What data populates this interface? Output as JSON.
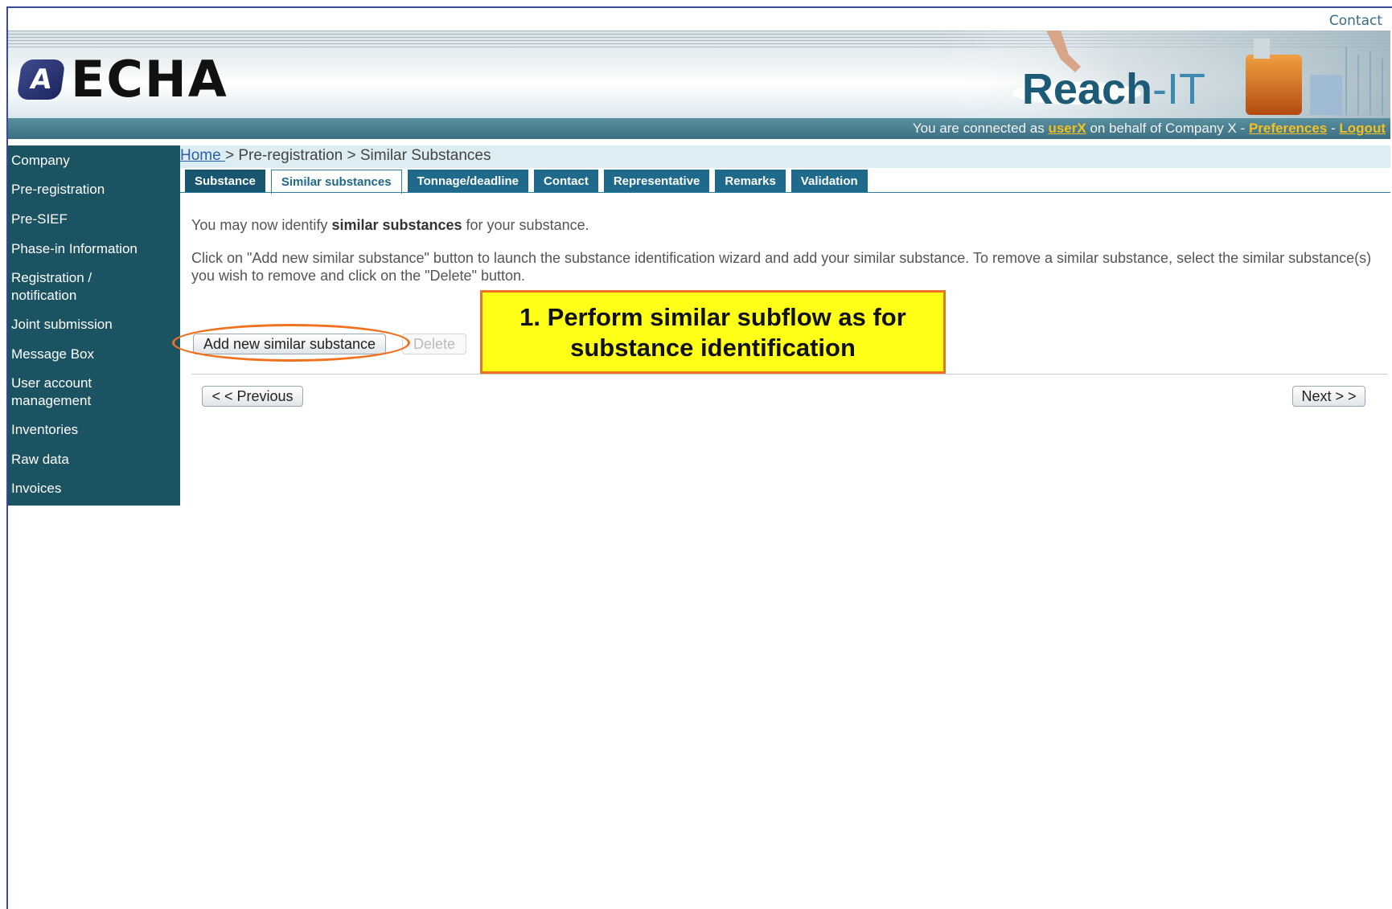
{
  "header": {
    "contact_link": "Contact",
    "logo_text": "ECHA",
    "logo_mark": "A",
    "product_name_main": "Reach",
    "product_name_suffix": "-IT",
    "connected_prefix": "You are connected as ",
    "user": "userX",
    "behalf_text": " on behalf of Company X - ",
    "preferences": "Preferences",
    "separator": " - ",
    "logout": "Logout"
  },
  "sidebar": {
    "items": [
      {
        "label": "Company"
      },
      {
        "label": "Pre-registration"
      },
      {
        "label": "Pre-SIEF"
      },
      {
        "label": "Phase-in Information"
      },
      {
        "label": "Registration / notification"
      },
      {
        "label": "Joint submission"
      },
      {
        "label": "Message Box"
      },
      {
        "label": "User account management"
      },
      {
        "label": "Inventories"
      },
      {
        "label": "Raw data"
      },
      {
        "label": "Invoices"
      }
    ]
  },
  "breadcrumb": {
    "home": "Home ",
    "rest": " > Pre-registration > Similar Substances"
  },
  "tabs": [
    {
      "label": "Substance"
    },
    {
      "label": "Similar substances"
    },
    {
      "label": "Tonnage/deadline"
    },
    {
      "label": "Contact"
    },
    {
      "label": "Representative"
    },
    {
      "label": "Remarks"
    },
    {
      "label": "Validation"
    }
  ],
  "content": {
    "intro_before": "You may now identify ",
    "intro_bold": "similar substances",
    "intro_after": " for your substance.",
    "instructions": "Click on \"Add new similar substance\" button to launch the substance identification wizard and add your similar substance. To remove a similar substance, select the similar substance(s) you wish to remove and click on the \"Delete\" button.",
    "add_button": "Add new similar substance",
    "delete_button": "Delete",
    "previous_button": "< < Previous",
    "next_button": "Next > >"
  },
  "callout": {
    "line1": "1. Perform similar subflow as for",
    "line2": "substance identification"
  },
  "colors": {
    "sidebar_bg": "#1b5363",
    "tab_bg": "#1f6a8a",
    "callout_bg": "#ffff17",
    "callout_border": "#ef7220",
    "link_highlight": "#f3c020"
  }
}
